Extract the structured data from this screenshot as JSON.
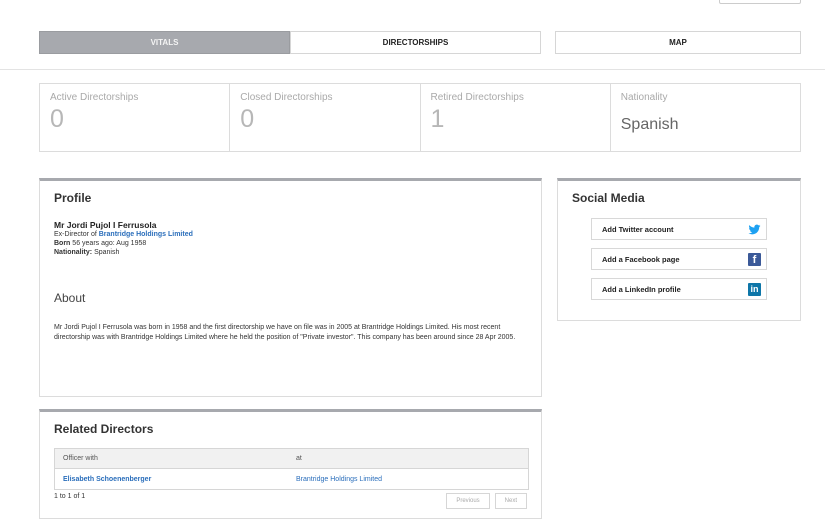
{
  "tabs": [
    "VITALS",
    "DIRECTORSHIPS",
    "MAP"
  ],
  "stats": [
    {
      "label": "Active Directorships",
      "value": "0"
    },
    {
      "label": "Closed Directorships",
      "value": "0"
    },
    {
      "label": "Retired Directorships",
      "value": "1"
    },
    {
      "label": "Nationality",
      "value": "Spanish"
    }
  ],
  "profile": {
    "title": "Profile",
    "name": "Mr Jordi Pujol I Ferrusola",
    "ex_director_prefix": "Ex-Director of",
    "ex_director_company": "Brantridge Holdings Limited",
    "born_label": "Born",
    "born_value": "56 years ago: Aug 1958",
    "nationality_label": "Nationality:",
    "nationality_value": "Spanish",
    "about_title": "About",
    "about_text": "Mr Jordi Pujol I Ferrusola was born in 1958 and the first directorship we have on file was in 2005 at Brantridge Holdings Limited. His most recent directorship was with Brantridge Holdings Limited where he held the position of \"Private investor\". This company has been around since 28 Apr 2005."
  },
  "social": {
    "title": "Social Media",
    "twitter": "Add Twitter account",
    "facebook": "Add a Facebook page",
    "linkedin": "Add a LinkedIn profile",
    "facebook_icon_text": "f",
    "linkedin_icon_text": "in",
    "twitter_color": "#1da1f2",
    "facebook_color": "#3b5998",
    "linkedin_color": "#0e76a8"
  },
  "related": {
    "title": "Related Directors",
    "col1": "Officer with",
    "col2": "at",
    "rows": [
      {
        "officer": "Elisabeth Schoenenberger",
        "company": "Brantridge Holdings Limited"
      }
    ],
    "count_text": "1 to 1 of 1",
    "previous": "Previous",
    "next": "Next"
  }
}
